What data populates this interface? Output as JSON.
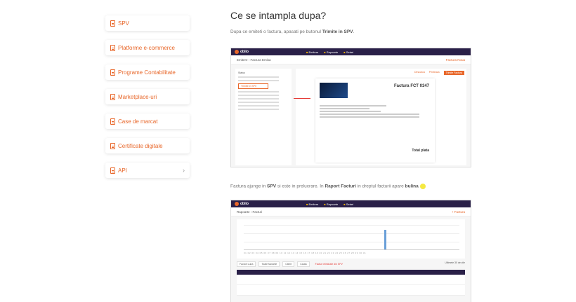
{
  "sidebar": {
    "items": [
      {
        "label": "SPV"
      },
      {
        "label": "Platforme e-commerce"
      },
      {
        "label": "Programe Contabilitate"
      },
      {
        "label": "Marketplace-uri"
      },
      {
        "label": "Case de marcat"
      },
      {
        "label": "Certificate digitale"
      },
      {
        "label": "API",
        "chevron": "›"
      }
    ]
  },
  "content": {
    "title": "Ce se intampla dupa?",
    "para1_prefix": "Dupa ce emiteti o factura, apasati pe butonul ",
    "para1_bold": "Trimite in SPV",
    "para1_suffix": ".",
    "para2_a": "Factura ajunge in ",
    "para2_b": "SPV",
    "para2_c": " si este in prelucrare. In ",
    "para2_d": "Raport Facturi",
    "para2_e": " in dreptul facturii apare ",
    "para2_f": "bulina",
    "dot_color": "#f5e942"
  },
  "screenshot1": {
    "logo": "oblio",
    "menu": [
      "Emitere",
      "Rapoarte",
      "Setari"
    ],
    "crumb": "Emitere › Factura Emisa",
    "crumb_action": "Factura Noua",
    "left_title": "Status",
    "spv_button": "Trimite in SPV",
    "tools": [
      "Descarca",
      "Printeaza",
      "Trimite Factura"
    ],
    "invoice_label": "Factura",
    "invoice_number": "FCT 0347",
    "invoice_total": "Total plata"
  },
  "screenshot2": {
    "logo": "oblio",
    "menu": [
      "Emitere",
      "Rapoarte",
      "Setari"
    ],
    "crumb": "Rapoarte › Facturi",
    "crumb_action": "+ Factura",
    "chart_ticks": "01 02 03 04 05 06 07 08 09 10 11 12 13 14 15 16 17 18 19 20 21 22 23 24 25 26 27 28 29 30 31",
    "filters": [
      "Facturi Luna",
      "Toate facturile",
      "Client",
      "Cauta",
      "Facturi eliminate din SPV"
    ],
    "total_label": "Ultimele 30 de zile"
  },
  "accent": "#e8672a",
  "topbar_color": "#2a2048"
}
